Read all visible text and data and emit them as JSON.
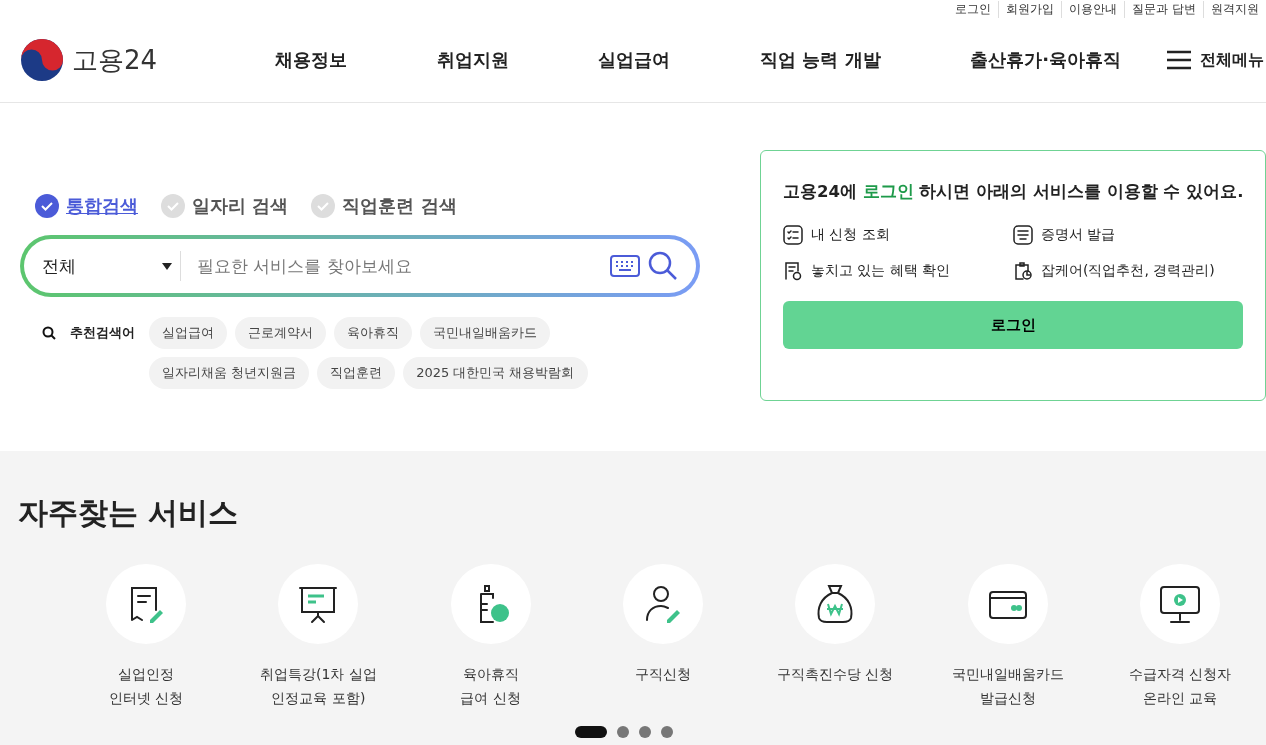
{
  "utility_links": [
    "로그인",
    "회원가입",
    "이용안내",
    "질문과 답변",
    "원격지원"
  ],
  "logo": {
    "text": "고용24"
  },
  "nav": [
    "채용정보",
    "취업지원",
    "실업급여",
    "직업 능력 개발",
    "출산휴가·육아휴직"
  ],
  "all_menu": "전체메뉴",
  "search_tabs": [
    {
      "label": "통합검색",
      "selected": true
    },
    {
      "label": "일자리 검색",
      "selected": false
    },
    {
      "label": "직업훈련 검색",
      "selected": false
    }
  ],
  "search": {
    "category": "전체",
    "placeholder": "필요한 서비스를 찾아보세요"
  },
  "recommended": {
    "label": "추천검색어",
    "keywords": [
      "실업급여",
      "근로계약서",
      "육아휴직",
      "국민내일배움카드",
      "일자리채움 청년지원금",
      "직업훈련",
      "2025 대한민국 채용박람회"
    ]
  },
  "login_card": {
    "title_before": "고용24에 ",
    "title_highlight": "로그인",
    "title_after": " 하시면 아래의 서비스를 이용할 수 있어요.",
    "features": [
      {
        "kind": "list",
        "label": "내 신청 조회"
      },
      {
        "kind": "certificate",
        "label": "증명서 발급"
      },
      {
        "kind": "receipt",
        "label": "놓치고 있는 혜택 확인"
      },
      {
        "kind": "clipboard",
        "label": "잡케어(직업추천, 경력관리)"
      }
    ],
    "button": "로그인"
  },
  "services": {
    "title": "자주찾는 서비스",
    "items": [
      {
        "kind": "document",
        "lines": [
          "실업인정",
          "인터넷 신청"
        ]
      },
      {
        "kind": "board",
        "lines": [
          "취업특강(1차 실업",
          "인정교육 포함)"
        ]
      },
      {
        "kind": "bottle",
        "lines": [
          "육아휴직",
          "급여 신청"
        ]
      },
      {
        "kind": "person",
        "lines": [
          "구직신청"
        ]
      },
      {
        "kind": "moneybag",
        "lines": [
          "구직촉진수당 신청"
        ]
      },
      {
        "kind": "card",
        "lines": [
          "국민내일배움카드",
          "발급신청"
        ]
      },
      {
        "kind": "monitor",
        "lines": [
          "수급자격 신청자",
          "온라인 교육"
        ]
      }
    ],
    "pages": [
      {
        "selected": true
      },
      {
        "selected": false
      },
      {
        "selected": false
      },
      {
        "selected": false
      }
    ]
  }
}
